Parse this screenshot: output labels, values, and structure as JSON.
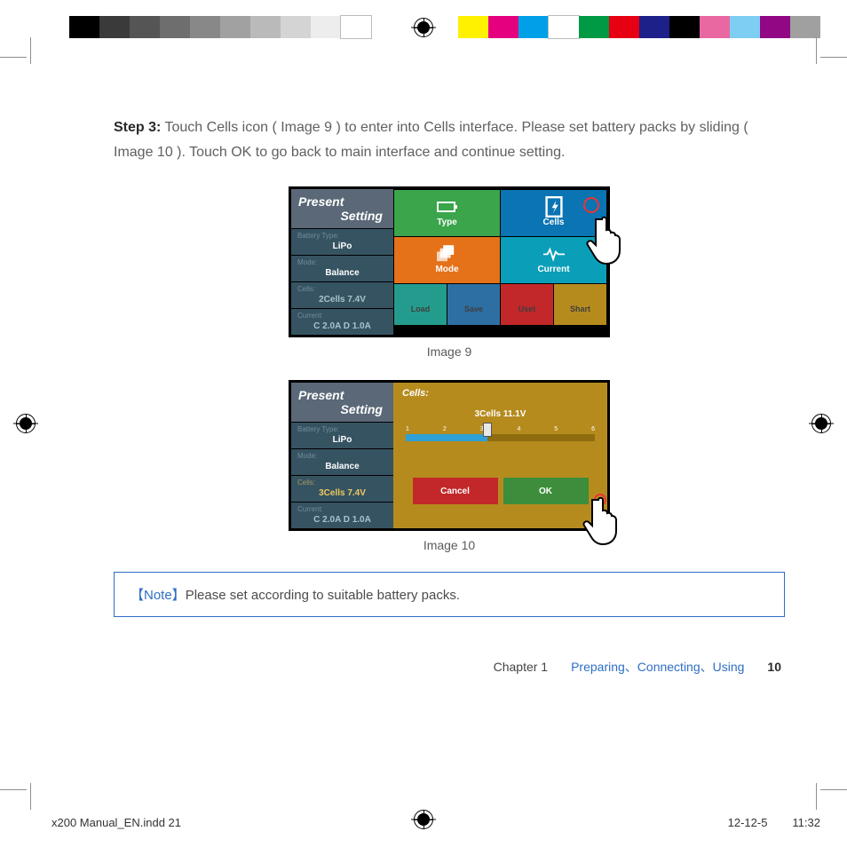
{
  "step": {
    "label": "Step 3:",
    "text": "Touch Cells icon ( Image 9 ) to enter into Cells interface. Please set battery packs by sliding ( Image 10 ). Touch OK to go back to main interface and continue setting."
  },
  "sidebar": {
    "title_l1": "Present",
    "title_l2": "Setting",
    "rows": {
      "type": {
        "label": "Battery Type:",
        "value": "LiPo"
      },
      "mode": {
        "label": "Mode:",
        "value": "Balance"
      },
      "cells9": {
        "label": "Cells:",
        "value": "2Cells  7.4V"
      },
      "cells10": {
        "label": "Cells:",
        "value": "3Cells  7.4V"
      },
      "current": {
        "label": "Current:",
        "value": "C 2.0A  D 1.0A"
      }
    }
  },
  "image9": {
    "caption": "Image 9",
    "tiles": {
      "type": "Type",
      "cells": "Cells",
      "mode": "Mode",
      "current": "Current",
      "load": "Load",
      "save": "Save",
      "uset": "Uset",
      "shart": "Shart"
    }
  },
  "image10": {
    "caption": "Image 10",
    "cells_label": "Cells:",
    "cells_value": "3Cells  11.1V",
    "ticks": [
      "1",
      "2",
      "3",
      "4",
      "5",
      "6"
    ],
    "cancel": "Cancel",
    "ok": "OK"
  },
  "note": {
    "tag": "【Note】",
    "text": "Please set according to suitable battery packs."
  },
  "footer": {
    "chapter": "Chapter 1",
    "links": "Preparing、Connecting、Using",
    "page": "10"
  },
  "indd": {
    "file": "x200 Manual_EN.indd   21",
    "date": "12-12-5",
    "time": "11:32"
  },
  "reg_colors_left": [
    "#000",
    "#3a3a3a",
    "#555",
    "#6e6e6e",
    "#888",
    "#a1a1a1",
    "#bababa",
    "#d4d4d4",
    "#ededed",
    "#fff"
  ],
  "reg_colors_right": [
    "#fff100",
    "#e4007f",
    "#00a0e9",
    "#fff",
    "#009944",
    "#e60012",
    "#1d2088",
    "#000",
    "#ea68a2",
    "#7ecef4",
    "#920783",
    "#a0a0a0"
  ]
}
